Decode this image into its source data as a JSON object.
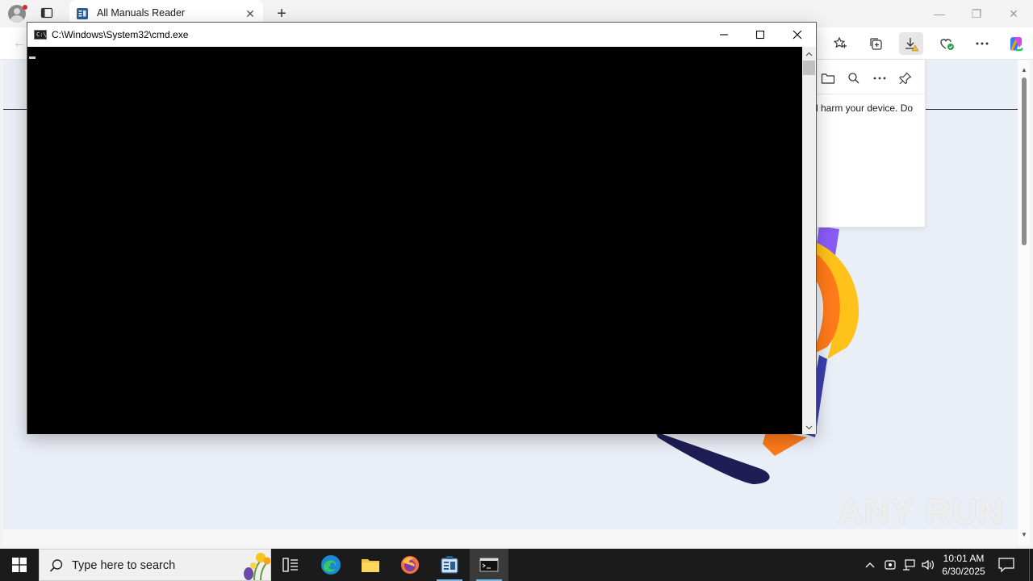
{
  "browser": {
    "tab_title": "All Manuals Reader",
    "tab_close": "✕",
    "new_tab": "+",
    "window_controls": {
      "minimize": "—",
      "restore": "❐",
      "close": "✕"
    }
  },
  "downloads_panel": {
    "warning_text": "l harm your device. Do"
  },
  "cmd_window": {
    "title": "C:\\Windows\\System32\\cmd.exe",
    "icon_text": "C:\\"
  },
  "watermark": {
    "text": "ANY RUN"
  },
  "taskbar": {
    "search_placeholder": "Type here to search",
    "time": "10:01 AM",
    "date": "6/30/2025"
  }
}
